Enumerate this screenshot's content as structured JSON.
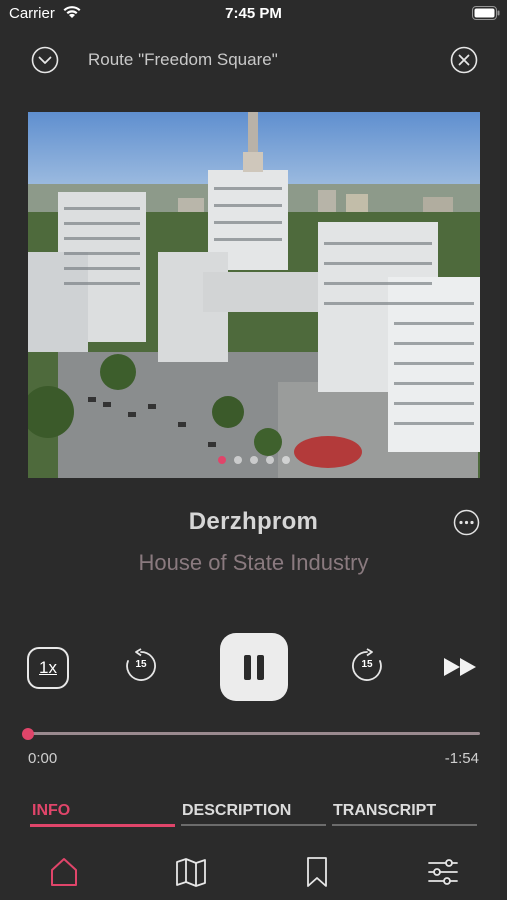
{
  "status_bar": {
    "carrier": "Carrier",
    "time": "7:45 PM"
  },
  "header": {
    "title": "Route \"Freedom Square\"",
    "collapse_icon": "chevron-down-circle-icon",
    "close_icon": "close-circle-icon"
  },
  "photo": {
    "description_icon": "photo-carousel",
    "page_count": 5,
    "active_index": 0
  },
  "track": {
    "title": "Derzhprom",
    "subtitle": "House of State Industry",
    "more_icon": "ellipsis-circle-icon"
  },
  "controls": {
    "speed_label": "1x",
    "rewind_seconds": "15",
    "forward_seconds": "15"
  },
  "progress": {
    "elapsed": "0:00",
    "remaining": "-1:54",
    "fraction": 0.0
  },
  "tabs": [
    {
      "label": "INFO",
      "active": true
    },
    {
      "label": "DESCRIPTION",
      "active": false
    },
    {
      "label": "TRANSCRIPT",
      "active": false
    }
  ],
  "bottom_nav": [
    {
      "icon": "home-icon",
      "active": true
    },
    {
      "icon": "map-icon",
      "active": false
    },
    {
      "icon": "bookmark-icon",
      "active": false
    },
    {
      "icon": "sliders-icon",
      "active": false
    }
  ],
  "colors": {
    "accent": "#e0456a",
    "background": "#2b2b2b"
  }
}
